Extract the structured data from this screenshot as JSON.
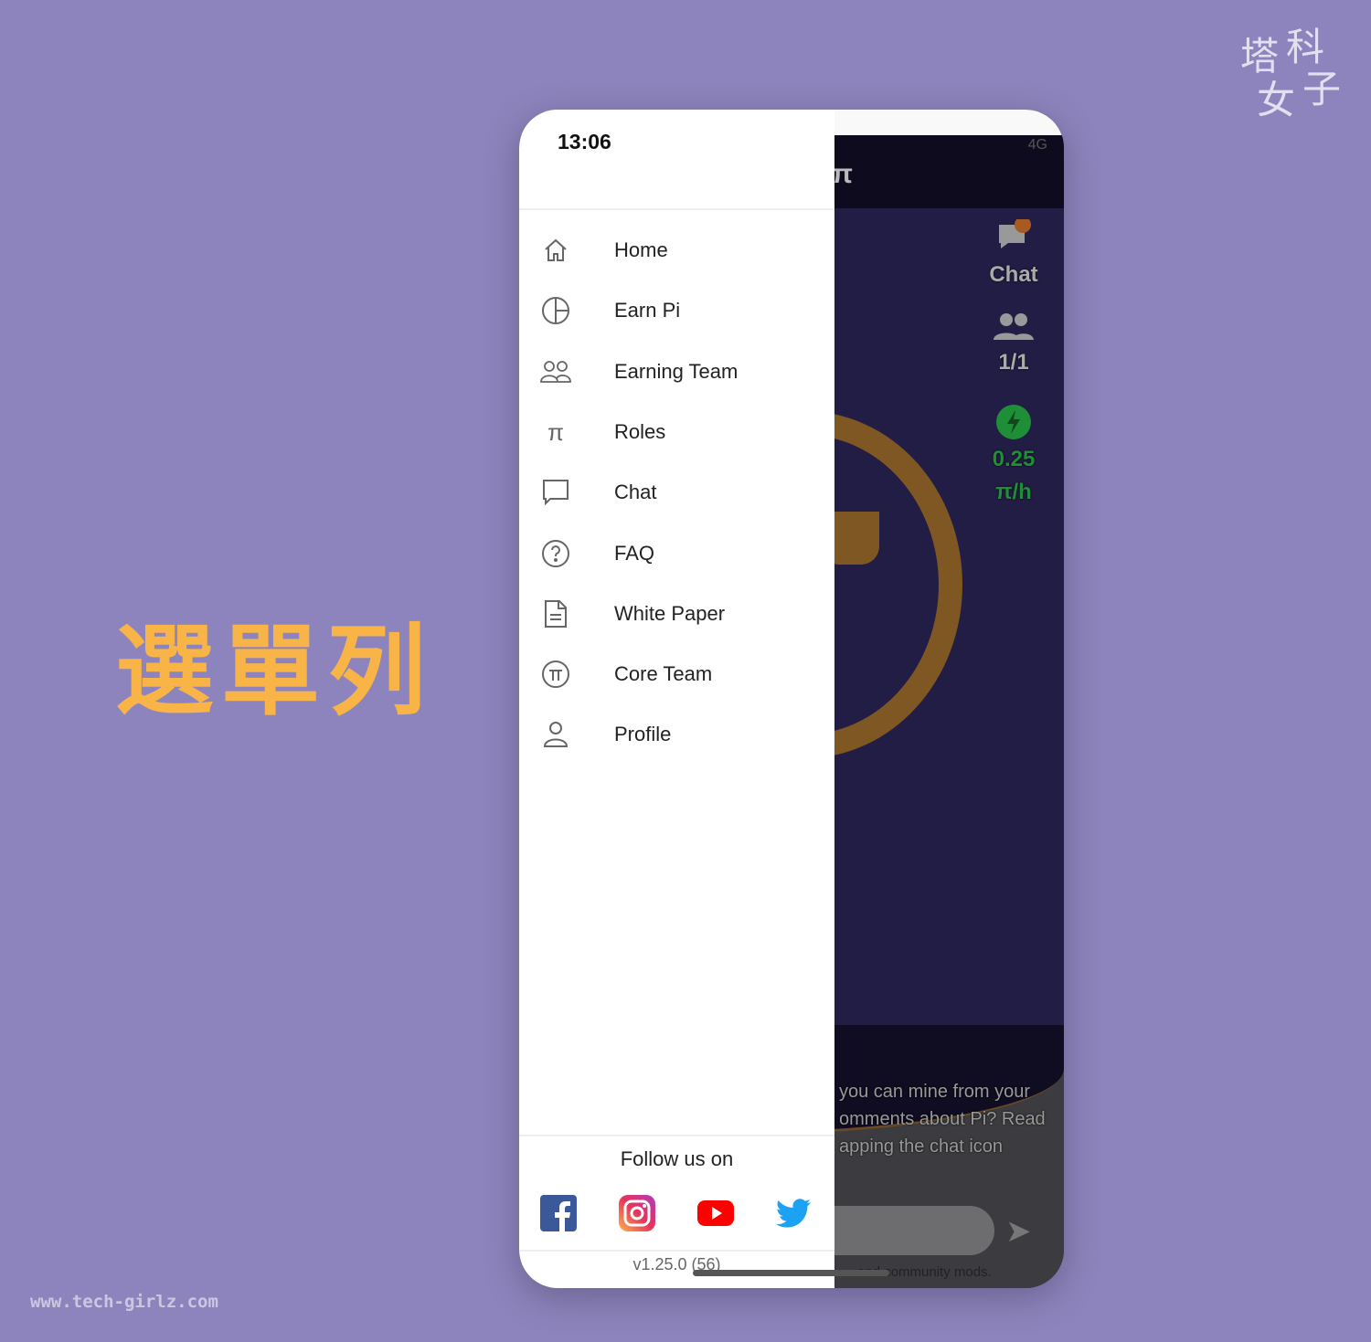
{
  "watermark": {
    "chars": [
      "塔",
      "科",
      "女",
      "子"
    ],
    "site": "www.tech-girlz.com"
  },
  "caption": "選單列",
  "status_bar": {
    "time": "13:06",
    "network": "4G"
  },
  "background_app": {
    "logo": "π",
    "side": [
      {
        "icon": "chat-icon",
        "label": "Chat"
      },
      {
        "icon": "people-icon",
        "label": "1/1"
      },
      {
        "icon": "lightning-icon",
        "label": "0.25",
        "unit": "π/h"
      }
    ],
    "message_lines": [
      "you can mine from your",
      "omments about Pi? Read",
      "apping the chat icon"
    ],
    "footer_text": "and community mods."
  },
  "drawer": {
    "items": [
      {
        "icon": "home-icon",
        "label": "Home"
      },
      {
        "icon": "pie-chart-icon",
        "label": "Earn Pi"
      },
      {
        "icon": "team-icon",
        "label": "Earning Team"
      },
      {
        "icon": "pi-icon",
        "label": "Roles"
      },
      {
        "icon": "chat-icon",
        "label": "Chat"
      },
      {
        "icon": "question-icon",
        "label": "FAQ"
      },
      {
        "icon": "document-icon",
        "label": "White Paper"
      },
      {
        "icon": "pi-circle-icon",
        "label": "Core Team"
      },
      {
        "icon": "person-icon",
        "label": "Profile"
      }
    ],
    "follow_label": "Follow us on",
    "social": [
      "facebook",
      "instagram",
      "youtube",
      "twitter"
    ],
    "version": "v1.25.0 (56)"
  },
  "colors": {
    "background": "#8d84bd",
    "caption": "#f8b446",
    "accent_green": "#1e8f36"
  }
}
